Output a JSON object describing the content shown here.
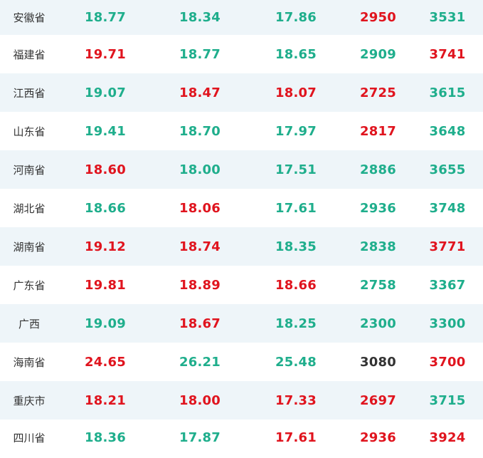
{
  "colors": {
    "green": "#1fae8c",
    "red": "#e0141e",
    "dark": "#333333"
  },
  "rows": [
    {
      "region": "安徽省",
      "cells": [
        {
          "value": "18.77",
          "color": "green"
        },
        {
          "value": "18.34",
          "color": "green"
        },
        {
          "value": "17.86",
          "color": "green"
        },
        {
          "value": "2950",
          "color": "red"
        },
        {
          "value": "3531",
          "color": "green"
        }
      ]
    },
    {
      "region": "福建省",
      "cells": [
        {
          "value": "19.71",
          "color": "red"
        },
        {
          "value": "18.77",
          "color": "green"
        },
        {
          "value": "18.65",
          "color": "green"
        },
        {
          "value": "2909",
          "color": "green"
        },
        {
          "value": "3741",
          "color": "red"
        }
      ]
    },
    {
      "region": "江西省",
      "cells": [
        {
          "value": "19.07",
          "color": "green"
        },
        {
          "value": "18.47",
          "color": "red"
        },
        {
          "value": "18.07",
          "color": "red"
        },
        {
          "value": "2725",
          "color": "red"
        },
        {
          "value": "3615",
          "color": "green"
        }
      ]
    },
    {
      "region": "山东省",
      "cells": [
        {
          "value": "19.41",
          "color": "green"
        },
        {
          "value": "18.70",
          "color": "green"
        },
        {
          "value": "17.97",
          "color": "green"
        },
        {
          "value": "2817",
          "color": "red"
        },
        {
          "value": "3648",
          "color": "green"
        }
      ]
    },
    {
      "region": "河南省",
      "cells": [
        {
          "value": "18.60",
          "color": "red"
        },
        {
          "value": "18.00",
          "color": "green"
        },
        {
          "value": "17.51",
          "color": "green"
        },
        {
          "value": "2886",
          "color": "green"
        },
        {
          "value": "3655",
          "color": "green"
        }
      ]
    },
    {
      "region": "湖北省",
      "cells": [
        {
          "value": "18.66",
          "color": "green"
        },
        {
          "value": "18.06",
          "color": "red"
        },
        {
          "value": "17.61",
          "color": "green"
        },
        {
          "value": "2936",
          "color": "green"
        },
        {
          "value": "3748",
          "color": "green"
        }
      ]
    },
    {
      "region": "湖南省",
      "cells": [
        {
          "value": "19.12",
          "color": "red"
        },
        {
          "value": "18.74",
          "color": "red"
        },
        {
          "value": "18.35",
          "color": "green"
        },
        {
          "value": "2838",
          "color": "green"
        },
        {
          "value": "3771",
          "color": "red"
        }
      ]
    },
    {
      "region": "广东省",
      "cells": [
        {
          "value": "19.81",
          "color": "red"
        },
        {
          "value": "18.89",
          "color": "red"
        },
        {
          "value": "18.66",
          "color": "red"
        },
        {
          "value": "2758",
          "color": "green"
        },
        {
          "value": "3367",
          "color": "green"
        }
      ]
    },
    {
      "region": "广西",
      "cells": [
        {
          "value": "19.09",
          "color": "green"
        },
        {
          "value": "18.67",
          "color": "red"
        },
        {
          "value": "18.25",
          "color": "green"
        },
        {
          "value": "2300",
          "color": "green"
        },
        {
          "value": "3300",
          "color": "green"
        }
      ]
    },
    {
      "region": "海南省",
      "cells": [
        {
          "value": "24.65",
          "color": "red"
        },
        {
          "value": "26.21",
          "color": "green"
        },
        {
          "value": "25.48",
          "color": "green"
        },
        {
          "value": "3080",
          "color": "dark"
        },
        {
          "value": "3700",
          "color": "red"
        }
      ]
    },
    {
      "region": "重庆市",
      "cells": [
        {
          "value": "18.21",
          "color": "red"
        },
        {
          "value": "18.00",
          "color": "red"
        },
        {
          "value": "17.33",
          "color": "red"
        },
        {
          "value": "2697",
          "color": "red"
        },
        {
          "value": "3715",
          "color": "green"
        }
      ]
    },
    {
      "region": "四川省",
      "cells": [
        {
          "value": "18.36",
          "color": "green"
        },
        {
          "value": "17.87",
          "color": "green"
        },
        {
          "value": "17.61",
          "color": "red"
        },
        {
          "value": "2936",
          "color": "red"
        },
        {
          "value": "3924",
          "color": "red"
        }
      ]
    }
  ]
}
